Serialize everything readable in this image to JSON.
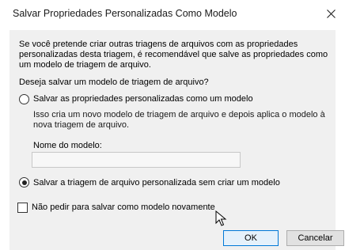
{
  "window": {
    "title": "Salvar Propriedades Personalizadas Como Modelo"
  },
  "icons": {
    "close": "close-icon",
    "cursor": "mouse-cursor"
  },
  "description": "Se você pretende criar outras triagens de arquivos com as propriedades personalizadas desta triagem, é recomendável que salve as propriedades como um modelo de triagem de arquivo.",
  "question": "Deseja salvar um modelo de triagem de arquivo?",
  "options": {
    "save_template_label": "Salvar as propriedades personalizadas como um modelo",
    "save_template_checked": false,
    "save_template_desc": "Isso cria um novo modelo de triagem de arquivo e depois aplica o modelo à nova triagem de arquivo.",
    "template_name_label": "Nome do modelo:",
    "template_name_value": "",
    "save_without_label": "Salvar a triagem de arquivo personalizada sem criar um modelo",
    "save_without_checked": true
  },
  "dont_ask": {
    "label": "Não pedir para salvar como modelo novamente",
    "checked": false
  },
  "buttons": {
    "ok": "OK",
    "cancel": "Cancelar"
  },
  "colors": {
    "accent": "#0078d7",
    "panel": "#f0f0f0"
  }
}
